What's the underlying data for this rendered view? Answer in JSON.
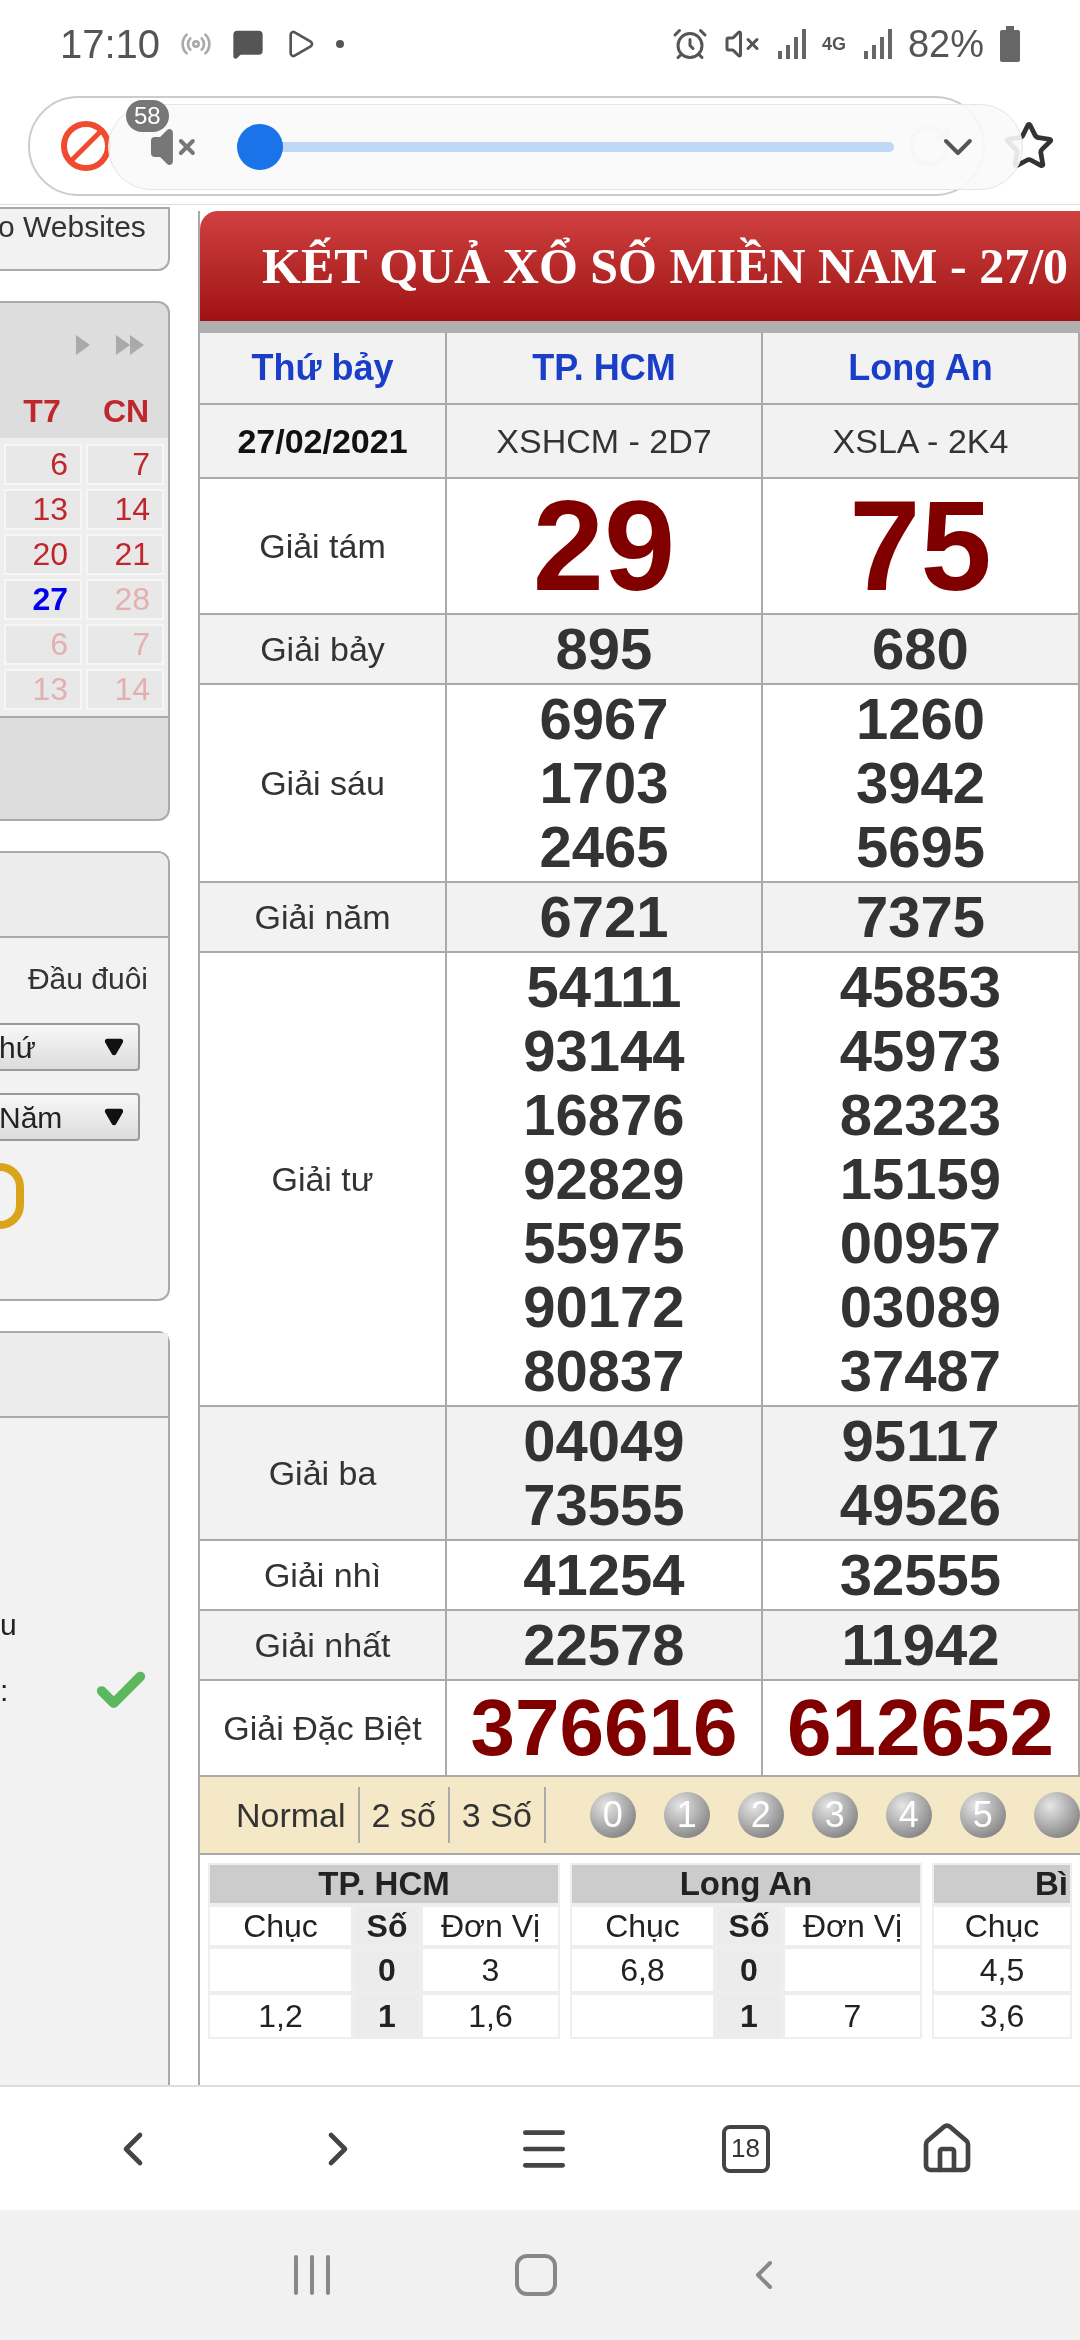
{
  "status_bar": {
    "time": "17:10",
    "network": "4G",
    "battery": "82%"
  },
  "browser": {
    "tab_badge": "58",
    "volume": {
      "muted": true,
      "level": 0.0
    },
    "tab_count": "18"
  },
  "sidebar": {
    "link_fragment": "o Websites",
    "calendar": {
      "days": [
        "T7",
        "CN"
      ],
      "weeks": [
        [
          {
            "day": "6",
            "faded": false,
            "selected": false
          },
          {
            "day": "7",
            "faded": false,
            "selected": false
          }
        ],
        [
          {
            "day": "13",
            "faded": false,
            "selected": false
          },
          {
            "day": "14",
            "faded": false,
            "selected": false
          }
        ],
        [
          {
            "day": "20",
            "faded": false,
            "selected": false
          },
          {
            "day": "21",
            "faded": false,
            "selected": false
          }
        ],
        [
          {
            "day": "27",
            "faded": false,
            "selected": true
          },
          {
            "day": "28",
            "faded": true,
            "selected": false
          }
        ],
        [
          {
            "day": "6",
            "faded": true,
            "selected": false
          },
          {
            "day": "7",
            "faded": true,
            "selected": false
          }
        ],
        [
          {
            "day": "13",
            "faded": true,
            "selected": false
          },
          {
            "day": "14",
            "faded": true,
            "selected": false
          }
        ]
      ]
    },
    "filter": {
      "label": "Đầu đuôi",
      "selects": [
        "hứ",
        "Năm"
      ]
    },
    "panel": {
      "fragments": [
        "u",
        ":"
      ]
    }
  },
  "results": {
    "title": "KẾT QUẢ XỔ SỐ MIỀN NAM - 27/0",
    "columns": [
      "Thứ bảy",
      "TP. HCM",
      "Long An"
    ],
    "date": "27/02/2021",
    "codes": [
      "XSHCM - 2D7",
      "XSLA - 2K4"
    ],
    "prizes": [
      {
        "name": "Giải tám",
        "kind": "big",
        "numbers": [
          [
            "29"
          ],
          [
            "75"
          ]
        ]
      },
      {
        "name": "Giải bảy",
        "kind": "normal",
        "numbers": [
          [
            "895"
          ],
          [
            "680"
          ]
        ]
      },
      {
        "name": "Giải sáu",
        "kind": "normal",
        "numbers": [
          [
            "6967",
            "1703",
            "2465"
          ],
          [
            "1260",
            "3942",
            "5695"
          ]
        ]
      },
      {
        "name": "Giải năm",
        "kind": "normal",
        "numbers": [
          [
            "6721"
          ],
          [
            "7375"
          ]
        ]
      },
      {
        "name": "Giải tư",
        "kind": "normal",
        "numbers": [
          [
            "54111",
            "93144",
            "16876",
            "92829",
            "55975",
            "90172",
            "80837"
          ],
          [
            "45853",
            "45973",
            "82323",
            "15159",
            "00957",
            "03089",
            "37487"
          ]
        ]
      },
      {
        "name": "Giải ba",
        "kind": "normal",
        "numbers": [
          [
            "04049",
            "73555"
          ],
          [
            "95117",
            "49526"
          ]
        ]
      },
      {
        "name": "Giải nhì",
        "kind": "normal",
        "numbers": [
          [
            "41254"
          ],
          [
            "32555"
          ]
        ]
      },
      {
        "name": "Giải nhất",
        "kind": "normal",
        "numbers": [
          [
            "22578"
          ],
          [
            "11942"
          ]
        ]
      },
      {
        "name": "Giải Đặc Biệt",
        "kind": "special",
        "numbers": [
          [
            "376616"
          ],
          [
            "612652"
          ]
        ]
      }
    ]
  },
  "loto": {
    "modes": [
      "Normal",
      "2 số",
      "3 Số"
    ],
    "balls": [
      "0",
      "1",
      "2",
      "3",
      "4",
      "5"
    ],
    "groups": [
      {
        "name": "TP. HCM",
        "headers": [
          "Chục",
          "Số",
          "Đơn Vị"
        ],
        "rows": [
          [
            null,
            "0",
            "3"
          ],
          [
            "1,2",
            "1",
            "1,6"
          ]
        ]
      },
      {
        "name": "Long An",
        "headers": [
          "Chục",
          "Số",
          "Đơn Vị"
        ],
        "rows": [
          [
            "6,8",
            "0",
            null
          ],
          [
            null,
            "1",
            "7"
          ]
        ]
      },
      {
        "name": "Bì",
        "headers": [
          "Chục"
        ],
        "rows": [
          [
            "4,5"
          ],
          [
            "3,6"
          ]
        ]
      }
    ]
  }
}
